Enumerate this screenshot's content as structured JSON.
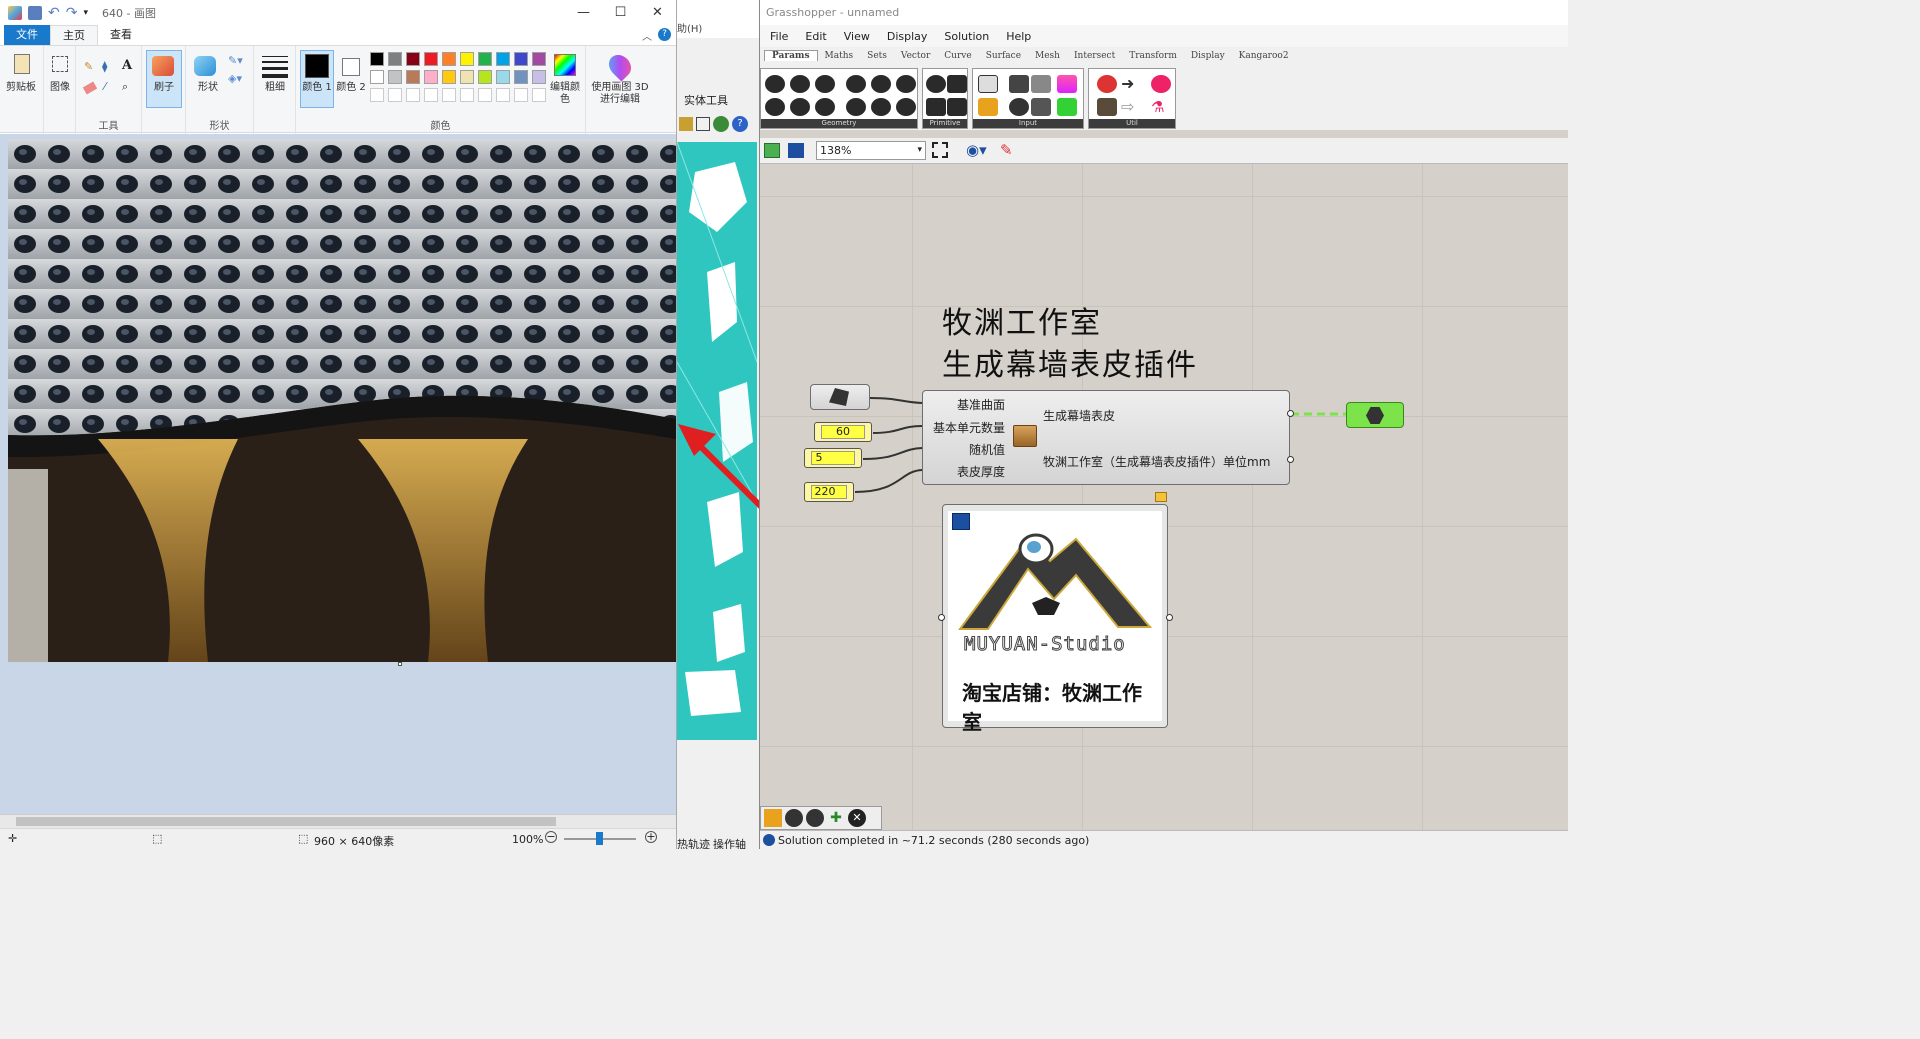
{
  "paint": {
    "title": "640 - 画图",
    "tabs": {
      "file": "文件",
      "home": "主页",
      "view": "查看"
    },
    "groups": {
      "tools": "工具",
      "shapes": "形状",
      "colors": "颜色"
    },
    "buttons": {
      "clipboard": "剪贴板",
      "image": "图像",
      "brush": "刷子",
      "shape": "形状",
      "size": "粗细",
      "color1": "颜色 1",
      "color2": "颜色 2",
      "edit_colors": "编辑颜色",
      "paint3d": "使用画图 3D 进行编辑"
    },
    "palette_row1": [
      "#000000",
      "#7f7f7f",
      "#880015",
      "#ed1c24",
      "#ff7f27",
      "#fff200",
      "#22b14c",
      "#00a2e8",
      "#3f48cc",
      "#a349a4"
    ],
    "palette_row2": [
      "#ffffff",
      "#c3c3c3",
      "#b97a57",
      "#ffaec9",
      "#ffc90e",
      "#efe4b0",
      "#b5e61d",
      "#99d9ea",
      "#7092be",
      "#c8bfe7"
    ],
    "status": {
      "size": "960 × 640像素",
      "zoom": "100%"
    }
  },
  "rhino_mid": {
    "help_menu": "助(H)",
    "tab": "实体工具",
    "bottom_a": "热轨迹",
    "bottom_b": "操作轴"
  },
  "gh": {
    "title": "Grasshopper - unnamed",
    "menu": [
      "File",
      "Edit",
      "View",
      "Display",
      "Solution",
      "Help"
    ],
    "tabs": [
      "Params",
      "Maths",
      "Sets",
      "Vector",
      "Curve",
      "Surface",
      "Mesh",
      "Intersect",
      "Transform",
      "Display",
      "Kangaroo2"
    ],
    "panels": [
      "Geometry",
      "Primitive",
      "Input",
      "Util"
    ],
    "zoom": "138%",
    "canvas": {
      "heading1": "牧渊工作室",
      "heading2": "生成幕墙表皮插件",
      "inputs": [
        "基准曲面",
        "基本单元数量",
        "随机值",
        "表皮厚度"
      ],
      "outputs": [
        "生成幕墙表皮",
        "牧渊工作室（生成幕墙表皮插件）单位mm"
      ],
      "sliders": [
        "60",
        "5",
        "220"
      ],
      "logo_text": "MUYUAN-Studio",
      "logo_caption": "淘宝店铺：牧渊工作室"
    },
    "status": "Solution completed in ~71.2 seconds (280 seconds ago)",
    "colors": {
      "cyan": "#2fc6c0",
      "arrow": "#e02020",
      "slider": "#ffff44",
      "green_param": "#7de34a"
    }
  }
}
